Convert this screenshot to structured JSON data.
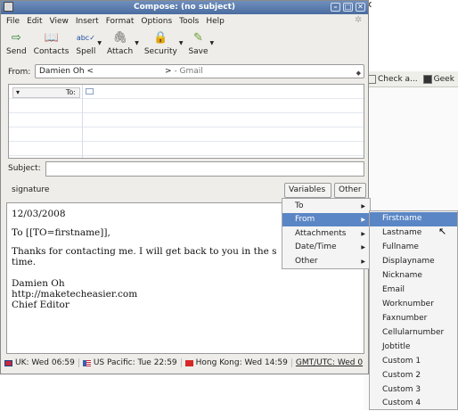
{
  "window": {
    "title": "Compose: (no subject)"
  },
  "menubar": [
    "File",
    "Edit",
    "View",
    "Insert",
    "Format",
    "Options",
    "Tools",
    "Help"
  ],
  "toolbar": [
    {
      "label": "Send",
      "icon": "send-icon",
      "arrow": false
    },
    {
      "label": "Contacts",
      "icon": "contacts-book-icon",
      "arrow": false
    },
    {
      "label": "Spell",
      "icon": "spellcheck-icon",
      "arrow": true
    },
    {
      "label": "Attach",
      "icon": "paperclip-icon",
      "arrow": true
    },
    {
      "label": "Security",
      "icon": "padlock-icon",
      "arrow": true
    },
    {
      "label": "Save",
      "icon": "save-icon",
      "arrow": true
    }
  ],
  "from": {
    "label": "From:",
    "value": "Damien Oh <",
    "value_end": ">",
    "account": "- Gmail"
  },
  "addressing": {
    "type": "To:"
  },
  "subject": {
    "label": "Subject:",
    "value": ""
  },
  "signature_bar": {
    "label": "signature",
    "variables_button": "Variables",
    "other_button": "Other"
  },
  "editor": {
    "lines": [
      "12/03/2008",
      "To [[TO=firstname]],",
      "Thanks for contacting me. I will get back to you in the s",
      "time.",
      "Damien Oh",
      "http://maketecheasier.com",
      "Chief Editor"
    ]
  },
  "statusbar": [
    {
      "label": "UK: Wed 06:59",
      "flag_color": "#c8283c"
    },
    {
      "label": "US Pacific: Tue 22:59",
      "flag_color": "#3b5da8"
    },
    {
      "label": "Hong Kong: Wed 14:59",
      "flag_color": "#d62828"
    },
    {
      "label": "GMT/UTC: Wed 0",
      "flag_color": ""
    }
  ],
  "variables_menu": [
    {
      "label": "To",
      "active": false
    },
    {
      "label": "From",
      "active": true
    },
    {
      "label": "Attachments",
      "active": false
    },
    {
      "label": "Date/Time",
      "active": false
    },
    {
      "label": "Other",
      "active": false
    }
  ],
  "from_submenu": [
    "Firstname",
    "Lastname",
    "Fullname",
    "Displayname",
    "Nickname",
    "Email",
    "Worknumber",
    "Faxnumber",
    "Cellularnumber",
    "Jobtitle",
    "Custom 1",
    "Custom 2",
    "Custom 3",
    "Custom 4"
  ],
  "background_browser": {
    "tabs": [
      "Check a...",
      "Geek"
    ]
  },
  "colors": {
    "titlebar": "#4a6c9f",
    "menu_highlight": "#5a86c5"
  }
}
